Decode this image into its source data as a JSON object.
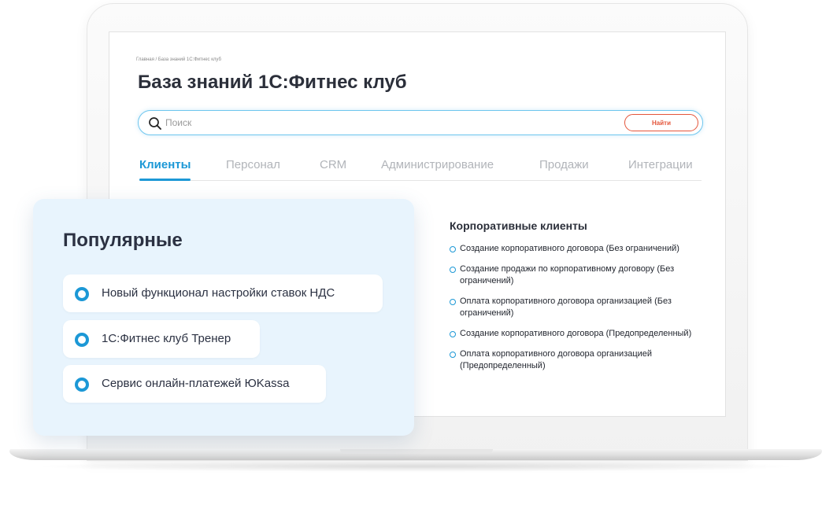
{
  "breadcrumb": "Главная / База знаний 1С:Фитнес клуб",
  "title": "База знаний 1С:Фитнес клуб",
  "search": {
    "placeholder": "Поиск",
    "button_label": "Найти"
  },
  "tabs": [
    {
      "label": "Клиенты",
      "active": true
    },
    {
      "label": "Персонал",
      "active": false
    },
    {
      "label": "CRM",
      "active": false
    },
    {
      "label": "Администрирование",
      "active": false
    },
    {
      "label": "Продажи",
      "active": false
    },
    {
      "label": "Интеграции",
      "active": false
    }
  ],
  "section": {
    "title": "Корпоративные клиенты",
    "items": [
      "Создание корпоративного договора (Без ограничений)",
      "Создание продажи по корпоративному договору (Без ограничений)",
      "Оплата корпоративного договора организацией (Без ограничений)",
      "Создание корпоративного договора (Предопределенный)",
      "Оплата корпоративного договора организацией (Предопределенный)"
    ]
  },
  "popular": {
    "title": "Популярные",
    "items": [
      "Новый функционал настройки ставок НДС",
      "1С:Фитнес клуб Тренер",
      "Сервис онлайн-платежей ЮKassa"
    ]
  },
  "colors": {
    "accent": "#1c98d6",
    "button": "#e4553a",
    "card_bg": "#e8f4fd",
    "text_dark": "#2b2f3a",
    "tab_inactive": "#b1b4b9"
  },
  "icons": {
    "search": "search-icon",
    "bullet": "circle-bullet-icon"
  }
}
